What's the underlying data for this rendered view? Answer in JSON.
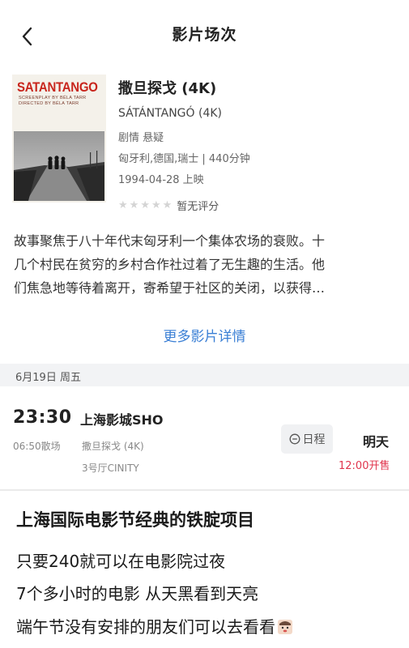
{
  "header": {
    "title": "影片场次"
  },
  "poster": {
    "title": "SATANTANGO",
    "credit_line_1": "SCREENPLAY BY BÉLA TARR",
    "credit_line_2": "DIRECTED BY BÉLA TARR"
  },
  "movie": {
    "title": "撒旦探戈 (4K)",
    "original_title": "SÁTÁNTANGÓ (4K)",
    "genre": "剧情 悬疑",
    "meta": "匈牙利,德国,瑞士 | 440分钟",
    "release": "1994-04-28 上映",
    "rating_text": "暂无评分",
    "rating_stars": 0
  },
  "synopsis": {
    "line1": "故事聚焦于八十年代末匈牙利一个集体农场的衰败。十",
    "line2": "几个村民在贫穷的乡村合作社过着了无生趣的生活。他",
    "line3": "们焦急地等待着离开，寄希望于社区的关闭，以获得…"
  },
  "more_link": "更多影片详情",
  "date_bar": {
    "label": "6月19日  周五"
  },
  "showtime": {
    "time": "23:30",
    "cinema": "上海影城SHO",
    "end_time": "06:50散场",
    "movie": "撒旦探戈 (4K)",
    "hall": "3号厅CINITY",
    "schedule_label": "日程",
    "day": "明天",
    "sale": "12:00开售"
  },
  "caption": {
    "line1": "上海国际电影节经典的铁腚项目",
    "line2": "只要240就可以在电影院过夜",
    "line3": "7个多小时的电影 从天黑看到天亮",
    "line4": "端午节没有安排的朋友们可以去看看"
  },
  "colors": {
    "accent_blue": "#3a7fd5",
    "sale_red": "#e0344c",
    "poster_red": "#c8251c"
  }
}
